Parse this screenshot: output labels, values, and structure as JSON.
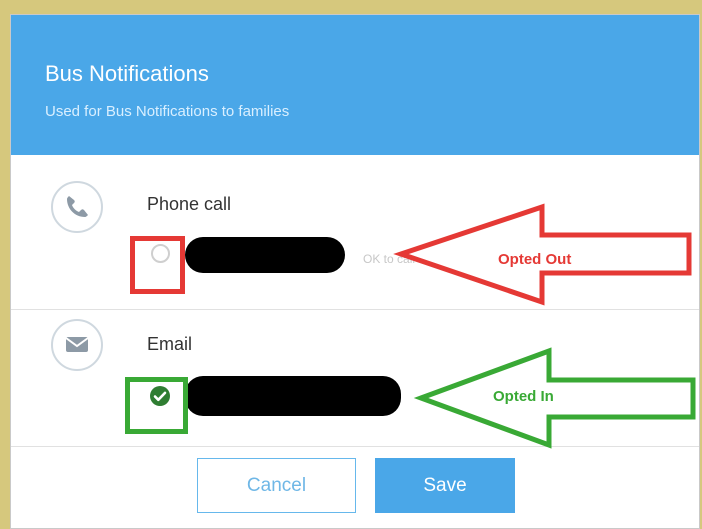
{
  "dialog": {
    "title": "Bus Notifications",
    "subtitle": "Used for Bus Notifications to families"
  },
  "channels": [
    {
      "label": "Phone call",
      "icon": "phone-icon",
      "status": "unselected",
      "consent_text": "OK to call"
    },
    {
      "label": "Email",
      "icon": "envelope-icon",
      "status": "selected"
    }
  ],
  "annotations": {
    "opted_out": "Opted Out",
    "opted_in": "Opted In",
    "opted_out_color": "#e53935",
    "opted_in_color": "#39a935"
  },
  "buttons": {
    "cancel": "Cancel",
    "save": "Save"
  },
  "colors": {
    "header": "#4aa7e8",
    "background": "#d6c87d",
    "check": "#2f7d32"
  }
}
